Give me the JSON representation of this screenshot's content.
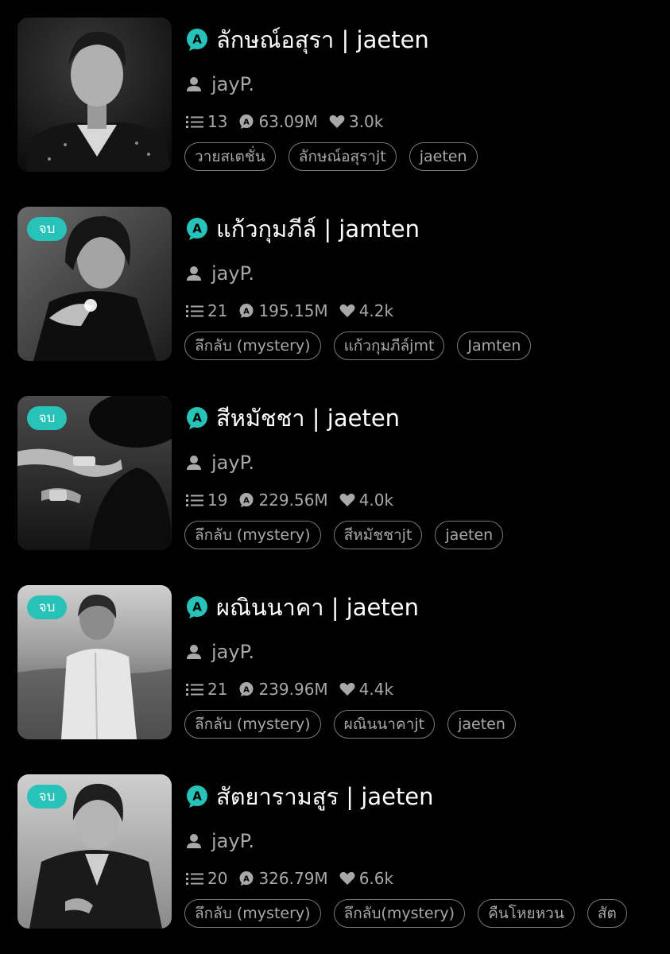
{
  "colors": {
    "accent": "#27c2b8",
    "background": "#000000",
    "muted_text": "#a8a8a8",
    "tag_border": "#7a7a7a"
  },
  "icons": {
    "app": "app-logo-icon",
    "author": "person-icon",
    "chapters": "list-icon",
    "views": "views-icon",
    "likes": "heart-icon"
  },
  "stories": [
    {
      "title": "ลักษณ์อสุรา | jaeten",
      "author": "jayP.",
      "chapters": "13",
      "views": "63.09M",
      "likes": "3.0k",
      "badge": "",
      "tags": [
        "วายสเตชั่น",
        "ลักษณ์อสุราjt",
        "jaeten"
      ]
    },
    {
      "title": "แก้วกุมภีล์ | jamten",
      "author": "jayP.",
      "chapters": "21",
      "views": "195.15M",
      "likes": "4.2k",
      "badge": "จบ",
      "tags": [
        "ลึกลับ (mystery)",
        "แก้วกุมภีล์jmt",
        "Jamten"
      ]
    },
    {
      "title": "สีหมัชชา | jaeten",
      "author": "jayP.",
      "chapters": "19",
      "views": "229.56M",
      "likes": "4.0k",
      "badge": "จบ",
      "tags": [
        "ลึกลับ (mystery)",
        "สีหมัชชาjt",
        "jaeten"
      ]
    },
    {
      "title": "ผณินนาคา | jaeten",
      "author": "jayP.",
      "chapters": "21",
      "views": "239.96M",
      "likes": "4.4k",
      "badge": "จบ",
      "tags": [
        "ลึกลับ (mystery)",
        "ผณินนาคาjt",
        "jaeten"
      ]
    },
    {
      "title": "สัตยารามสูร | jaeten",
      "author": "jayP.",
      "chapters": "20",
      "views": "326.79M",
      "likes": "6.6k",
      "badge": "จบ",
      "tags": [
        "ลึกลับ (mystery)",
        "ลึกลับ(mystery)",
        "คืนโหยหวน",
        "สัต"
      ]
    }
  ]
}
